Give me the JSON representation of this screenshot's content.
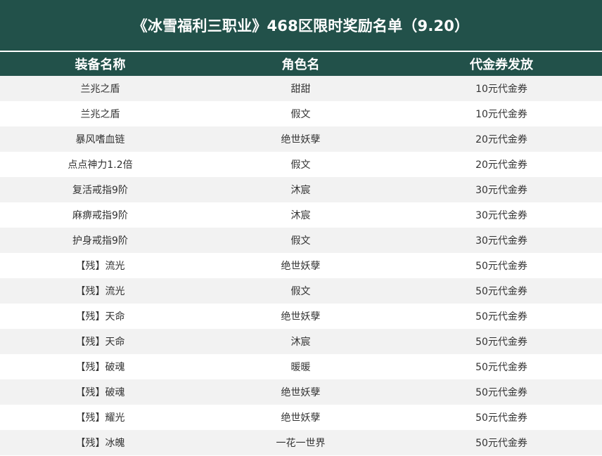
{
  "title": "《冰雪福利三职业》468区限时奖励名单（9.20）",
  "columns": [
    "装备名称",
    "角色名",
    "代金券发放"
  ],
  "rows": [
    [
      "兰兆之盾",
      "甜甜",
      "10元代金券"
    ],
    [
      "兰兆之盾",
      "假文",
      "10元代金券"
    ],
    [
      "暴风嗜血链",
      "绝世妖孽",
      "20元代金券"
    ],
    [
      "点点神力1.2倍",
      "假文",
      "20元代金券"
    ],
    [
      "复活戒指9阶",
      "沐宸",
      "30元代金券"
    ],
    [
      "麻痹戒指9阶",
      "沐宸",
      "30元代金券"
    ],
    [
      "护身戒指9阶",
      "假文",
      "30元代金券"
    ],
    [
      "【残】流光",
      "绝世妖孽",
      "50元代金券"
    ],
    [
      "【残】流光",
      "假文",
      "50元代金券"
    ],
    [
      "【残】天命",
      "绝世妖孽",
      "50元代金券"
    ],
    [
      "【残】天命",
      "沐宸",
      "50元代金券"
    ],
    [
      "【残】破魂",
      "暖暖",
      "50元代金券"
    ],
    [
      "【残】破魂",
      "绝世妖孽",
      "50元代金券"
    ],
    [
      "【残】耀光",
      "绝世妖孽",
      "50元代金券"
    ],
    [
      "【残】冰魄",
      "一花一世界",
      "50元代金券"
    ]
  ],
  "colors": {
    "header_bg": "#22514a",
    "header_text": "#ffffff",
    "row_stripe": "#f2f2f2",
    "row_text": "#333333"
  }
}
